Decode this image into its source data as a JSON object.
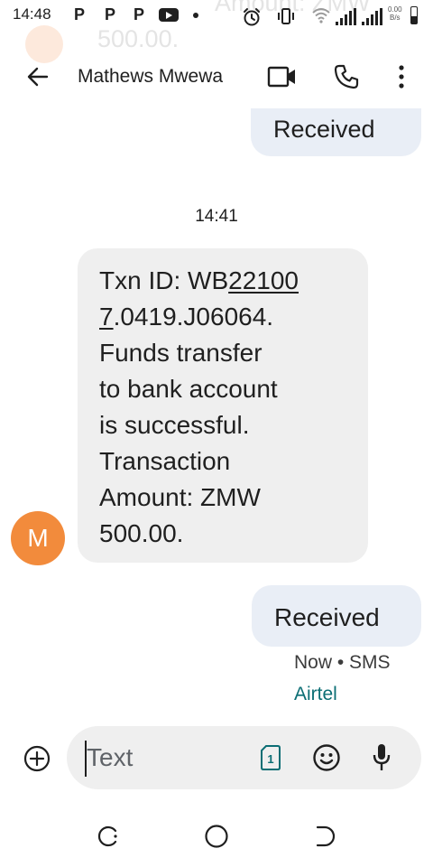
{
  "status_bar": {
    "time": "14:48",
    "app_badges": [
      "P",
      "P",
      "P"
    ],
    "net_speed_value": "0.00",
    "net_speed_unit": "B/s"
  },
  "notification_ghost": {
    "line1": "Amount: ZMW",
    "line2": "500.00."
  },
  "header": {
    "contact_name": "Mathews Mwewa"
  },
  "conversation": {
    "previous_message_label": "Received",
    "time_divider": "14:41",
    "incoming": {
      "avatar_letter": "M",
      "avatar_color": "#f28b3c",
      "lines": [
        {
          "pre": "Txn ID: WB",
          "link": "22100"
        },
        {
          "pre": "",
          "link": "7",
          "post": ".0419.J06064."
        },
        {
          "pre": "Funds transfer"
        },
        {
          "pre": "to bank account"
        },
        {
          "pre": "is successful."
        },
        {
          "pre": "Transaction"
        },
        {
          "pre": "Amount: ZMW"
        },
        {
          "pre": "500.00."
        }
      ]
    },
    "outgoing": {
      "label": "Received",
      "status": "Now • SMS",
      "sim_name": "Airtel",
      "sim_color": "#0b6e74"
    }
  },
  "compose": {
    "placeholder": "Text",
    "sim_slot": "1"
  },
  "nav_bar": {
    "recents": "recents-icon",
    "home": "home-icon",
    "back": "back-icon"
  }
}
